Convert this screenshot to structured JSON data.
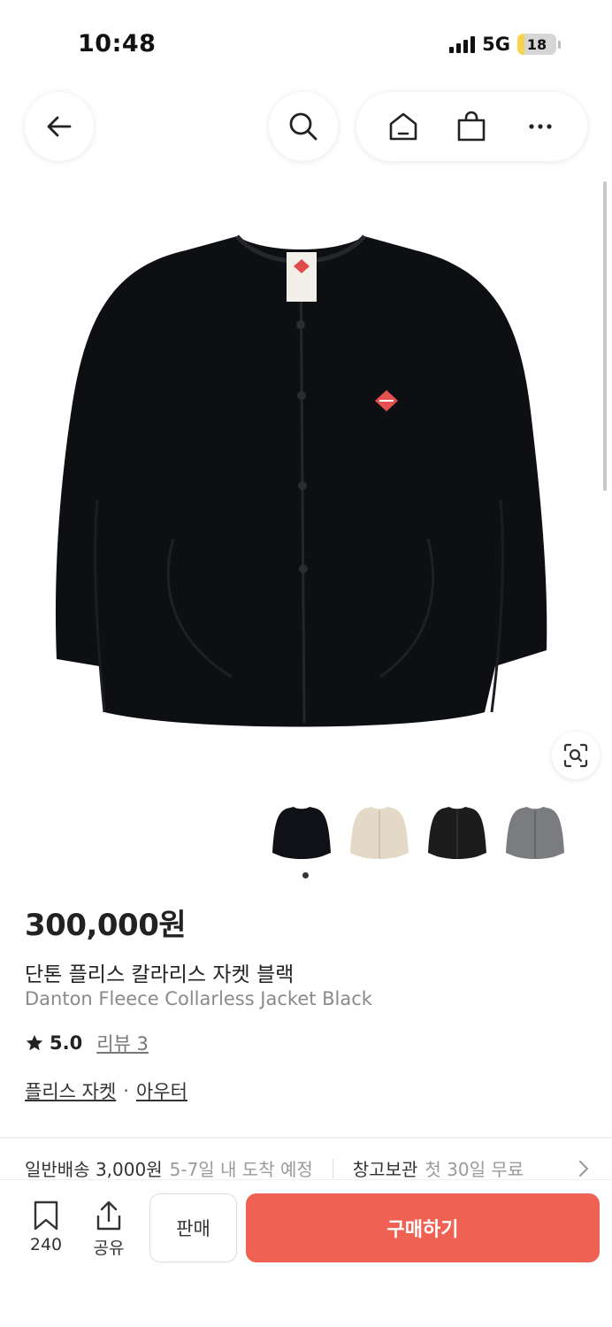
{
  "status": {
    "time": "10:48",
    "network": "5G",
    "battery": "18",
    "battery_level": 0.18
  },
  "nav": {
    "back_icon": "arrow-left-icon",
    "search_icon": "search-icon",
    "home_icon": "home-icon",
    "bag_icon": "shopping-bag-icon",
    "more_icon": "more-horizontal-icon"
  },
  "product": {
    "price": "300,000원",
    "title_ko": "단톤 플리스 칼라리스 자켓 블랙",
    "title_en": "Danton Fleece Collarless Jacket Black",
    "rating": "5.0",
    "review_label": "리뷰 3",
    "categories": [
      "플리스 자켓",
      "아우터"
    ],
    "category_separator": "·",
    "thumbnails": [
      {
        "color": "#0f1116"
      },
      {
        "color": "#e4d9c6"
      },
      {
        "color": "#1c1c1c"
      },
      {
        "color": "#7b7c80"
      }
    ]
  },
  "shipping": {
    "standard_label": "일반배송 3,000원",
    "standard_eta": "5-7일 내 도착 예정",
    "warehouse_label": "창고보관",
    "warehouse_note": "첫 30일 무료"
  },
  "bottom": {
    "save_count": "240",
    "share_label": "공유",
    "sell_label": "판매",
    "buy_label": "구매하기"
  },
  "colors": {
    "accent": "#ef6253",
    "text": "#222222",
    "muted": "#8a8a8a"
  }
}
